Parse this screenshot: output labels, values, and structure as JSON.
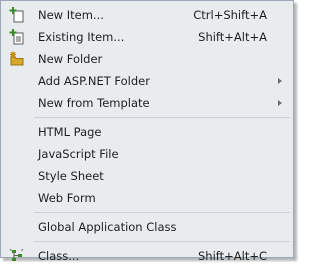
{
  "menu": {
    "items": [
      {
        "label": "New Item...",
        "shortcut": "Ctrl+Shift+A",
        "icon": "new-item-icon"
      },
      {
        "label": "Existing Item...",
        "shortcut": "Shift+Alt+A",
        "icon": "existing-item-icon"
      },
      {
        "label": "New Folder",
        "icon": "new-folder-icon"
      },
      {
        "label": "Add ASP.NET Folder",
        "submenu": true
      },
      {
        "label": "New from Template",
        "submenu": true
      },
      {
        "label": "HTML Page"
      },
      {
        "label": "JavaScript File"
      },
      {
        "label": "Style Sheet"
      },
      {
        "label": "Web Form"
      },
      {
        "label": "Global Application Class"
      },
      {
        "label": "Class...",
        "shortcut": "Shift+Alt+C",
        "icon": "class-icon"
      }
    ]
  },
  "colors": {
    "menu_background": "#e9ecee",
    "menu_border": "#9ba7b7",
    "text": "#1e1e1e",
    "separator": "#cdd2d8",
    "icon_green": "#3a8a2a",
    "folder_yellow": "#d9a72a"
  }
}
